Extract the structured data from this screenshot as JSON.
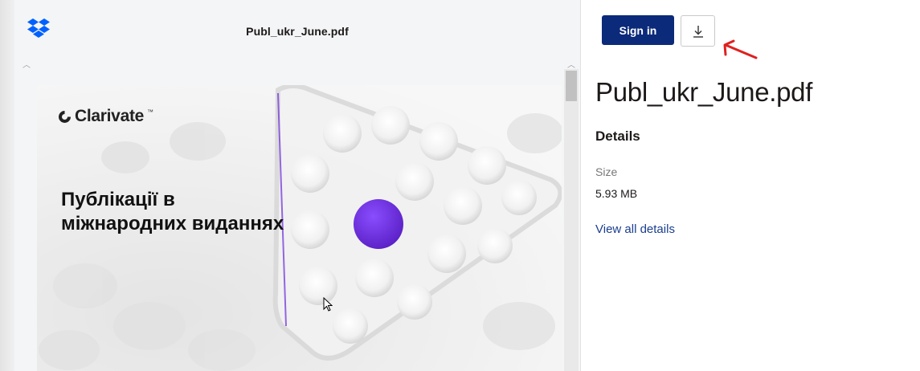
{
  "viewer": {
    "filename": "Publ_ukr_June.pdf",
    "pdf": {
      "logo_text": "Clarivate",
      "logo_tm": "™",
      "heading_line1": "Публікації в",
      "heading_line2": "міжнародних виданнях"
    }
  },
  "sidebar": {
    "sign_in_label": "Sign in",
    "download_icon": "download-icon",
    "file_title": "Publ_ukr_June.pdf",
    "details_heading": "Details",
    "size_label": "Size",
    "size_value": "5.93 MB",
    "view_all_label": "View all details"
  },
  "colors": {
    "accent_button": "#0b2a7a",
    "link": "#1a3e8f",
    "annotation_arrow": "#e02020",
    "pdf_purple": "#6c2bd9",
    "dropbox_blue": "#0061fe"
  }
}
